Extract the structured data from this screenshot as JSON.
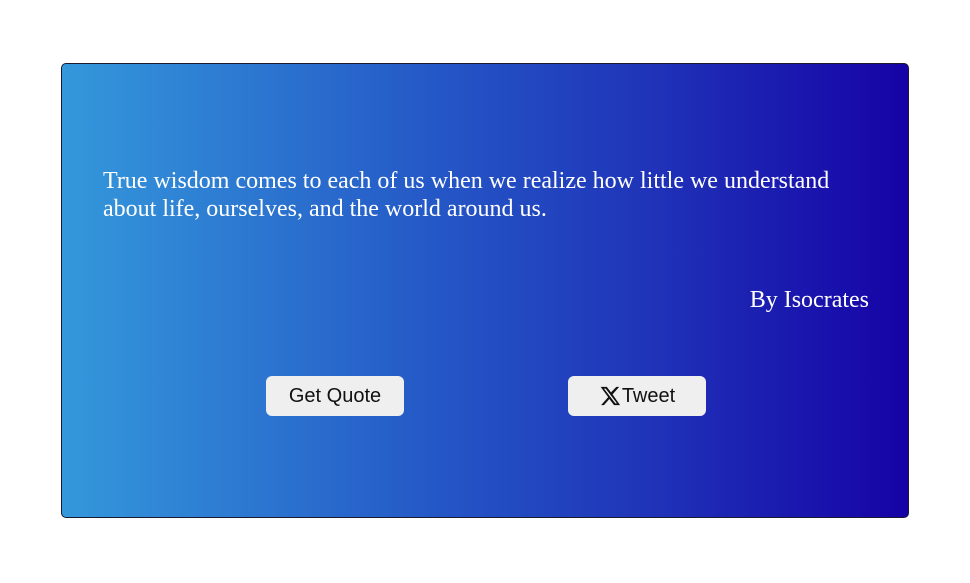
{
  "quote": {
    "text": "True wisdom comes to each of us when we realize how little we understand about life, ourselves, and the world around us.",
    "author": "By Isocrates"
  },
  "buttons": {
    "get_quote_label": "Get Quote",
    "tweet_label": "Tweet",
    "tweet_icon": "x-logo-icon"
  },
  "colors": {
    "gradient_start": "#3498db",
    "gradient_end": "#1602a6",
    "button_bg": "#efefef",
    "text": "#ffffff"
  }
}
